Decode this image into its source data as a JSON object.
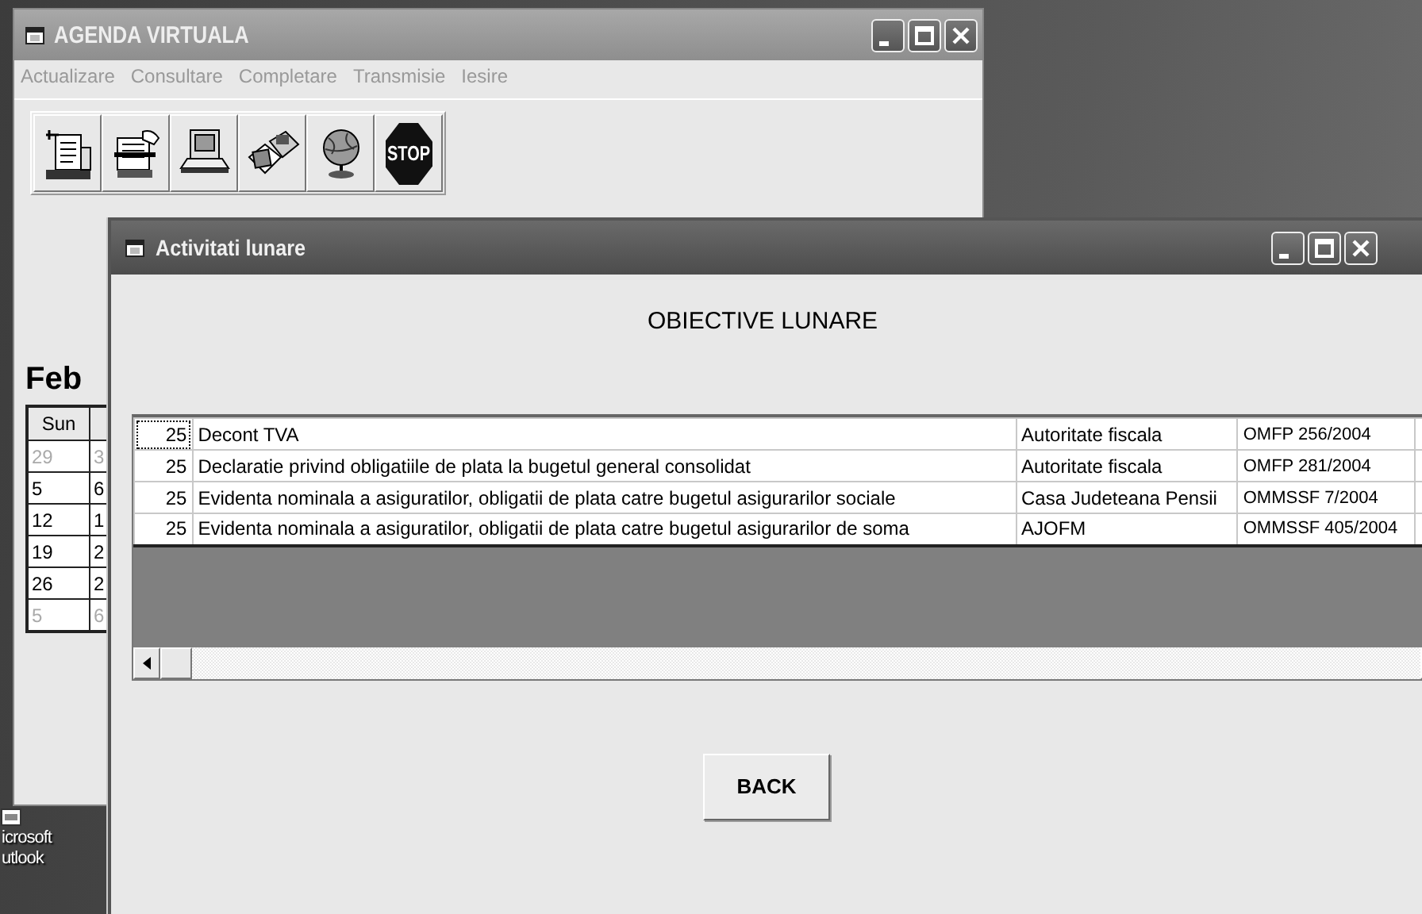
{
  "desktop_icons": [
    {
      "lines": [
        "icrosoft",
        "utlook"
      ]
    }
  ],
  "main_window": {
    "title": "AGENDA VIRTUALA",
    "menu": [
      "Actualizare",
      "Consultare",
      "Completare",
      "Transmisie",
      "Iesire"
    ],
    "toolbar": [
      {
        "kind": "document"
      },
      {
        "kind": "cardfile"
      },
      {
        "kind": "computer"
      },
      {
        "kind": "disks"
      },
      {
        "kind": "globe"
      },
      {
        "kind": "stop",
        "label": "STOP"
      }
    ],
    "calendar": {
      "month": "Feb",
      "columns": [
        "Sun"
      ],
      "rows": [
        {
          "cells": [
            "29",
            "3"
          ],
          "other_month": true
        },
        {
          "cells": [
            "5",
            "6"
          ],
          "other_month": false
        },
        {
          "cells": [
            "12",
            "1"
          ],
          "other_month": false
        },
        {
          "cells": [
            "19",
            "2"
          ],
          "other_month": false
        },
        {
          "cells": [
            "26",
            "2"
          ],
          "other_month": false
        },
        {
          "cells": [
            "5",
            "6"
          ],
          "other_month": true
        }
      ]
    }
  },
  "dialog": {
    "title": "Activitati lunare",
    "heading": "OBIECTIVE LUNARE",
    "table": {
      "rows": [
        {
          "day": "25",
          "description": "Decont TVA",
          "authority": "Autoritate fiscala",
          "reference": "OMFP 256/2004",
          "focused": true
        },
        {
          "day": "25",
          "description": "Declaratie privind obligatiile de plata la bugetul general consolidat",
          "authority": "Autoritate fiscala",
          "reference": "OMFP 281/2004",
          "focused": false
        },
        {
          "day": "25",
          "description": "Evidenta nominala a asiguratilor, obligatii de plata catre bugetul asigurarilor sociale",
          "authority": "Casa Judeteana Pensii",
          "reference": "OMMSSF 7/2004",
          "focused": false
        },
        {
          "day": "25",
          "description": "Evidenta nominala a asiguratilor, obligatii de plata catre bugetul asigurarilor de soma",
          "authority": "AJOFM",
          "reference": "OMMSSF 405/2004",
          "focused": false
        }
      ]
    },
    "button": "BACK"
  }
}
